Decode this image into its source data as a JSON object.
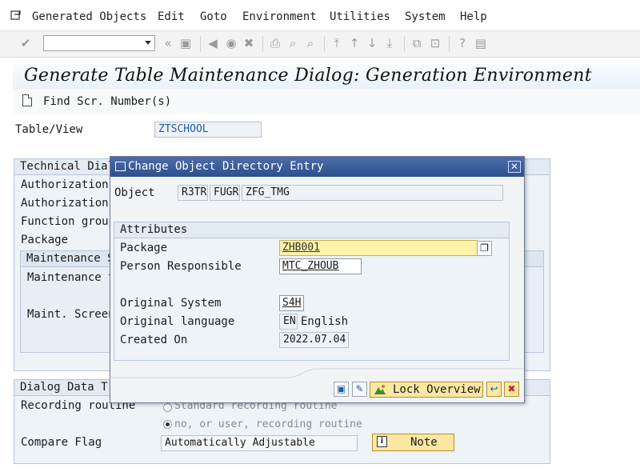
{
  "menu": {
    "items": [
      {
        "label": "Generated Objects"
      },
      {
        "label": "Edit"
      },
      {
        "label": "Goto"
      },
      {
        "label": "Environment"
      },
      {
        "label": "Utilities"
      },
      {
        "label": "System"
      },
      {
        "label": "Help"
      }
    ]
  },
  "title": "Generate Table Maintenance Dialog: Generation Environment",
  "appbar": {
    "find_label": "Find Scr. Number(s)"
  },
  "table_view": {
    "label": "Table/View",
    "value": "ZTSCHOOL"
  },
  "tech_group": {
    "title": "Technical Dial",
    "rows": [
      "Authorization",
      "Authorization",
      "Function group",
      "Package"
    ],
    "maint_group_title": "Maintenance S",
    "maint_type_label": "Maintenance t",
    "maint_screen_label": "Maint. Screen"
  },
  "dialog_group": {
    "title": "Dialog Data Tr",
    "recording_label": "Recording routine",
    "radio_standard": "Standard recording routine",
    "radio_user": "no, or user, recording routine",
    "compare_label": "Compare Flag",
    "compare_value": "Automatically Adjustable",
    "note_label": "Note"
  },
  "dialog": {
    "title": "Change Object Directory Entry",
    "object_label": "Object",
    "object_pgmid": "R3TR",
    "object_type": "FUGR",
    "object_name": "ZFG_TMG",
    "attributes_title": "Attributes",
    "package_label": "Package",
    "package_value": "ZHB001",
    "person_label": "Person Responsible",
    "person_value": "MTC_ZHOUB",
    "orig_system_label": "Original System",
    "orig_system_value": "S4H",
    "orig_lang_label": "Original language",
    "orig_lang_code": "EN",
    "orig_lang_text": "English",
    "created_label": "Created On",
    "created_value": "2022.07.04",
    "lock_overview_label": "Lock Overview"
  },
  "colors": {
    "dialog_title_bg": "#2d4f8f",
    "required_field_bg": "#fff3a8",
    "button_bg": "#fbe7a4"
  }
}
